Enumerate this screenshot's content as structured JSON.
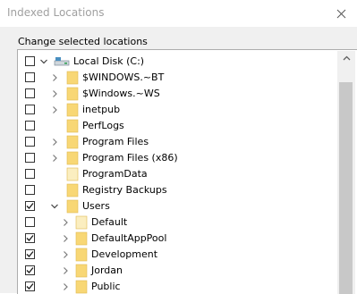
{
  "window": {
    "title": "Indexed Locations"
  },
  "group": {
    "label": "Change selected locations"
  },
  "tree": {
    "rows": [
      {
        "label": "Local Disk (C:)",
        "checked": false,
        "expander": "chevron-down",
        "icon": "drive-icon"
      },
      {
        "label": "$WINDOWS.~BT",
        "checked": false,
        "expander": "chevron-right",
        "icon": "folder-icon"
      },
      {
        "label": "$Windows.~WS",
        "checked": false,
        "expander": "chevron-right",
        "icon": "folder-icon"
      },
      {
        "label": "inetpub",
        "checked": false,
        "expander": "chevron-right",
        "icon": "folder-icon"
      },
      {
        "label": "PerfLogs",
        "checked": false,
        "expander": "none",
        "icon": "folder-icon"
      },
      {
        "label": "Program Files",
        "checked": false,
        "expander": "chevron-right",
        "icon": "folder-icon"
      },
      {
        "label": "Program Files (x86)",
        "checked": false,
        "expander": "chevron-right",
        "icon": "folder-icon"
      },
      {
        "label": "ProgramData",
        "checked": false,
        "expander": "none",
        "icon": "folder-faded-icon"
      },
      {
        "label": "Registry Backups",
        "checked": false,
        "expander": "none",
        "icon": "folder-icon"
      },
      {
        "label": "Users",
        "checked": true,
        "expander": "chevron-down",
        "icon": "folder-icon"
      },
      {
        "label": "Default",
        "checked": false,
        "expander": "chevron-right",
        "icon": "folder-faded-icon"
      },
      {
        "label": "DefaultAppPool",
        "checked": true,
        "expander": "chevron-right",
        "icon": "folder-icon"
      },
      {
        "label": "Development",
        "checked": true,
        "expander": "chevron-right",
        "icon": "folder-icon"
      },
      {
        "label": "Jordan",
        "checked": true,
        "expander": "chevron-right",
        "icon": "folder-icon"
      },
      {
        "label": "Public",
        "checked": true,
        "expander": "chevron-right",
        "icon": "folder-icon"
      }
    ]
  },
  "colors": {
    "folder": "#f8d775",
    "folder_faded": "#fbeec0",
    "drive": "#4a8fc0"
  }
}
